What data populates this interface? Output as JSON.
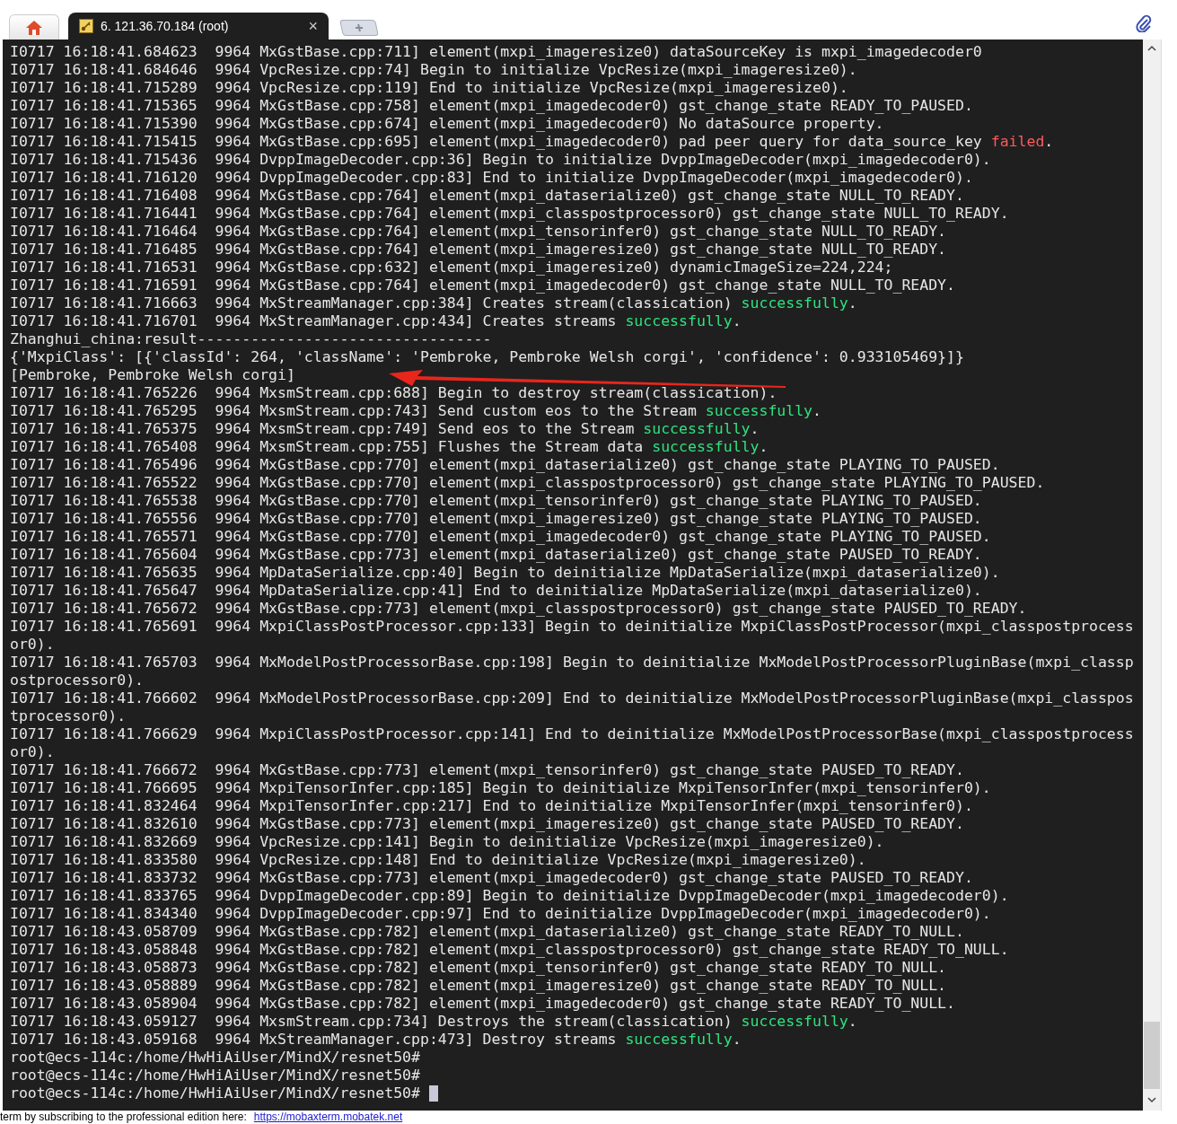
{
  "tabs": [
    {
      "kind": "home",
      "selected": false
    },
    {
      "kind": "session",
      "label": "6. 121.36.70.184 (root)",
      "close": "×",
      "selected": true
    },
    {
      "kind": "new",
      "selected": false
    }
  ],
  "terminal": {
    "cursor_visible": true,
    "lines": [
      {
        "segments": [
          {
            "kind": "plain",
            "text": "I0717 16:18:41.684623  9964 MxGstBase.cpp:711] element(mxpi_imageresize0) dataSourceKey is mxpi_imagedecoder0"
          }
        ]
      },
      {
        "segments": [
          {
            "kind": "plain",
            "text": "I0717 16:18:41.684646  9964 VpcResize.cpp:74] Begin to initialize VpcResize(mxpi_imageresize0)."
          }
        ]
      },
      {
        "segments": [
          {
            "kind": "plain",
            "text": "I0717 16:18:41.715289  9964 VpcResize.cpp:119] End to initialize VpcResize(mxpi_imageresize0)."
          }
        ]
      },
      {
        "segments": [
          {
            "kind": "plain",
            "text": "I0717 16:18:41.715365  9964 MxGstBase.cpp:758] element(mxpi_imagedecoder0) gst_change_state READY_TO_PAUSED."
          }
        ]
      },
      {
        "segments": [
          {
            "kind": "plain",
            "text": "I0717 16:18:41.715390  9964 MxGstBase.cpp:674] element(mxpi_imagedecoder0) No dataSource property."
          }
        ]
      },
      {
        "segments": [
          {
            "kind": "plain",
            "text": "I0717 16:18:41.715415  9964 MxGstBase.cpp:695] element(mxpi_imagedecoder0) pad peer query for data_source_key "
          },
          {
            "kind": "error",
            "text": "failed"
          },
          {
            "kind": "plain",
            "text": "."
          }
        ]
      },
      {
        "segments": [
          {
            "kind": "plain",
            "text": "I0717 16:18:41.715436  9964 DvppImageDecoder.cpp:36] Begin to initialize DvppImageDecoder(mxpi_imagedecoder0)."
          }
        ]
      },
      {
        "segments": [
          {
            "kind": "plain",
            "text": "I0717 16:18:41.716120  9964 DvppImageDecoder.cpp:83] End to initialize DvppImageDecoder(mxpi_imagedecoder0)."
          }
        ]
      },
      {
        "segments": [
          {
            "kind": "plain",
            "text": "I0717 16:18:41.716408  9964 MxGstBase.cpp:764] element(mxpi_dataserialize0) gst_change_state NULL_TO_READY."
          }
        ]
      },
      {
        "segments": [
          {
            "kind": "plain",
            "text": "I0717 16:18:41.716441  9964 MxGstBase.cpp:764] element(mxpi_classpostprocessor0) gst_change_state NULL_TO_READY."
          }
        ]
      },
      {
        "segments": [
          {
            "kind": "plain",
            "text": "I0717 16:18:41.716464  9964 MxGstBase.cpp:764] element(mxpi_tensorinfer0) gst_change_state NULL_TO_READY."
          }
        ]
      },
      {
        "segments": [
          {
            "kind": "plain",
            "text": "I0717 16:18:41.716485  9964 MxGstBase.cpp:764] element(mxpi_imageresize0) gst_change_state NULL_TO_READY."
          }
        ]
      },
      {
        "segments": [
          {
            "kind": "plain",
            "text": "I0717 16:18:41.716531  9964 MxGstBase.cpp:632] element(mxpi_imageresize0) dynamicImageSize=224,224;"
          }
        ]
      },
      {
        "segments": [
          {
            "kind": "plain",
            "text": "I0717 16:18:41.716591  9964 MxGstBase.cpp:764] element(mxpi_imagedecoder0) gst_change_state NULL_TO_READY."
          }
        ]
      },
      {
        "segments": [
          {
            "kind": "plain",
            "text": "I0717 16:18:41.716663  9964 MxStreamManager.cpp:384] Creates stream(classication) "
          },
          {
            "kind": "success",
            "text": "successfully"
          },
          {
            "kind": "plain",
            "text": "."
          }
        ]
      },
      {
        "segments": [
          {
            "kind": "plain",
            "text": "I0717 16:18:41.716701  9964 MxStreamManager.cpp:434] Creates streams "
          },
          {
            "kind": "success",
            "text": "successfully"
          },
          {
            "kind": "plain",
            "text": "."
          }
        ]
      },
      {
        "segments": [
          {
            "kind": "plain",
            "text": "Zhanghui_china:result---------------------------------"
          }
        ]
      },
      {
        "segments": [
          {
            "kind": "plain",
            "text": "{'MxpiClass': [{'classId': 264, 'className': 'Pembroke, Pembroke Welsh corgi', 'confidence': 0.933105469}]}"
          }
        ]
      },
      {
        "segments": [
          {
            "kind": "plain",
            "text": "[Pembroke, Pembroke Welsh corgi]"
          }
        ]
      },
      {
        "segments": [
          {
            "kind": "plain",
            "text": "I0717 16:18:41.765226  9964 MxsmStream.cpp:688] Begin to destroy stream(classication)."
          }
        ]
      },
      {
        "segments": [
          {
            "kind": "plain",
            "text": "I0717 16:18:41.765295  9964 MxsmStream.cpp:743] Send custom eos to the Stream "
          },
          {
            "kind": "success",
            "text": "successfully"
          },
          {
            "kind": "plain",
            "text": "."
          }
        ]
      },
      {
        "segments": [
          {
            "kind": "plain",
            "text": "I0717 16:18:41.765375  9964 MxsmStream.cpp:749] Send eos to the Stream "
          },
          {
            "kind": "success",
            "text": "successfully"
          },
          {
            "kind": "plain",
            "text": "."
          }
        ]
      },
      {
        "segments": [
          {
            "kind": "plain",
            "text": "I0717 16:18:41.765408  9964 MxsmStream.cpp:755] Flushes the Stream data "
          },
          {
            "kind": "success",
            "text": "successfully"
          },
          {
            "kind": "plain",
            "text": "."
          }
        ]
      },
      {
        "segments": [
          {
            "kind": "plain",
            "text": "I0717 16:18:41.765496  9964 MxGstBase.cpp:770] element(mxpi_dataserialize0) gst_change_state PLAYING_TO_PAUSED."
          }
        ]
      },
      {
        "segments": [
          {
            "kind": "plain",
            "text": "I0717 16:18:41.765522  9964 MxGstBase.cpp:770] element(mxpi_classpostprocessor0) gst_change_state PLAYING_TO_PAUSED."
          }
        ]
      },
      {
        "segments": [
          {
            "kind": "plain",
            "text": "I0717 16:18:41.765538  9964 MxGstBase.cpp:770] element(mxpi_tensorinfer0) gst_change_state PLAYING_TO_PAUSED."
          }
        ]
      },
      {
        "segments": [
          {
            "kind": "plain",
            "text": "I0717 16:18:41.765556  9964 MxGstBase.cpp:770] element(mxpi_imageresize0) gst_change_state PLAYING_TO_PAUSED."
          }
        ]
      },
      {
        "segments": [
          {
            "kind": "plain",
            "text": "I0717 16:18:41.765571  9964 MxGstBase.cpp:770] element(mxpi_imagedecoder0) gst_change_state PLAYING_TO_PAUSED."
          }
        ]
      },
      {
        "segments": [
          {
            "kind": "plain",
            "text": "I0717 16:18:41.765604  9964 MxGstBase.cpp:773] element(mxpi_dataserialize0) gst_change_state PAUSED_TO_READY."
          }
        ]
      },
      {
        "segments": [
          {
            "kind": "plain",
            "text": "I0717 16:18:41.765635  9964 MpDataSerialize.cpp:40] Begin to deinitialize MpDataSerialize(mxpi_dataserialize0)."
          }
        ]
      },
      {
        "segments": [
          {
            "kind": "plain",
            "text": "I0717 16:18:41.765647  9964 MpDataSerialize.cpp:41] End to deinitialize MpDataSerialize(mxpi_dataserialize0)."
          }
        ]
      },
      {
        "segments": [
          {
            "kind": "plain",
            "text": "I0717 16:18:41.765672  9964 MxGstBase.cpp:773] element(mxpi_classpostprocessor0) gst_change_state PAUSED_TO_READY."
          }
        ]
      },
      {
        "segments": [
          {
            "kind": "plain",
            "text": "I0717 16:18:41.765691  9964 MxpiClassPostProcessor.cpp:133] Begin to deinitialize MxpiClassPostProcessor(mxpi_classpostprocess"
          }
        ]
      },
      {
        "segments": [
          {
            "kind": "plain",
            "text": "or0)."
          }
        ]
      },
      {
        "segments": [
          {
            "kind": "plain",
            "text": "I0717 16:18:41.765703  9964 MxModelPostProcessorBase.cpp:198] Begin to deinitialize MxModelPostProcessorPluginBase(mxpi_classp"
          }
        ]
      },
      {
        "segments": [
          {
            "kind": "plain",
            "text": "ostprocessor0)."
          }
        ]
      },
      {
        "segments": [
          {
            "kind": "plain",
            "text": "I0717 16:18:41.766602  9964 MxModelPostProcessorBase.cpp:209] End to deinitialize MxModelPostProcessorPluginBase(mxpi_classpos"
          }
        ]
      },
      {
        "segments": [
          {
            "kind": "plain",
            "text": "tprocessor0)."
          }
        ]
      },
      {
        "segments": [
          {
            "kind": "plain",
            "text": "I0717 16:18:41.766629  9964 MxpiClassPostProcessor.cpp:141] End to deinitialize MxModelPostProcessorBase(mxpi_classpostprocess"
          }
        ]
      },
      {
        "segments": [
          {
            "kind": "plain",
            "text": "or0)."
          }
        ]
      },
      {
        "segments": [
          {
            "kind": "plain",
            "text": "I0717 16:18:41.766672  9964 MxGstBase.cpp:773] element(mxpi_tensorinfer0) gst_change_state PAUSED_TO_READY."
          }
        ]
      },
      {
        "segments": [
          {
            "kind": "plain",
            "text": "I0717 16:18:41.766695  9964 MxpiTensorInfer.cpp:185] Begin to deinitialize MxpiTensorInfer(mxpi_tensorinfer0)."
          }
        ]
      },
      {
        "segments": [
          {
            "kind": "plain",
            "text": "I0717 16:18:41.832464  9964 MxpiTensorInfer.cpp:217] End to deinitialize MxpiTensorInfer(mxpi_tensorinfer0)."
          }
        ]
      },
      {
        "segments": [
          {
            "kind": "plain",
            "text": "I0717 16:18:41.832610  9964 MxGstBase.cpp:773] element(mxpi_imageresize0) gst_change_state PAUSED_TO_READY."
          }
        ]
      },
      {
        "segments": [
          {
            "kind": "plain",
            "text": "I0717 16:18:41.832669  9964 VpcResize.cpp:141] Begin to deinitialize VpcResize(mxpi_imageresize0)."
          }
        ]
      },
      {
        "segments": [
          {
            "kind": "plain",
            "text": "I0717 16:18:41.833580  9964 VpcResize.cpp:148] End to deinitialize VpcResize(mxpi_imageresize0)."
          }
        ]
      },
      {
        "segments": [
          {
            "kind": "plain",
            "text": "I0717 16:18:41.833732  9964 MxGstBase.cpp:773] element(mxpi_imagedecoder0) gst_change_state PAUSED_TO_READY."
          }
        ]
      },
      {
        "segments": [
          {
            "kind": "plain",
            "text": "I0717 16:18:41.833765  9964 DvppImageDecoder.cpp:89] Begin to deinitialize DvppImageDecoder(mxpi_imagedecoder0)."
          }
        ]
      },
      {
        "segments": [
          {
            "kind": "plain",
            "text": "I0717 16:18:41.834340  9964 DvppImageDecoder.cpp:97] End to deinitialize DvppImageDecoder(mxpi_imagedecoder0)."
          }
        ]
      },
      {
        "segments": [
          {
            "kind": "plain",
            "text": "I0717 16:18:43.058709  9964 MxGstBase.cpp:782] element(mxpi_dataserialize0) gst_change_state READY_TO_NULL."
          }
        ]
      },
      {
        "segments": [
          {
            "kind": "plain",
            "text": "I0717 16:18:43.058848  9964 MxGstBase.cpp:782] element(mxpi_classpostprocessor0) gst_change_state READY_TO_NULL."
          }
        ]
      },
      {
        "segments": [
          {
            "kind": "plain",
            "text": "I0717 16:18:43.058873  9964 MxGstBase.cpp:782] element(mxpi_tensorinfer0) gst_change_state READY_TO_NULL."
          }
        ]
      },
      {
        "segments": [
          {
            "kind": "plain",
            "text": "I0717 16:18:43.058889  9964 MxGstBase.cpp:782] element(mxpi_imageresize0) gst_change_state READY_TO_NULL."
          }
        ]
      },
      {
        "segments": [
          {
            "kind": "plain",
            "text": "I0717 16:18:43.058904  9964 MxGstBase.cpp:782] element(mxpi_imagedecoder0) gst_change_state READY_TO_NULL."
          }
        ]
      },
      {
        "segments": [
          {
            "kind": "plain",
            "text": "I0717 16:18:43.059127  9964 MxsmStream.cpp:734] Destroys the stream(classication) "
          },
          {
            "kind": "success",
            "text": "successfully"
          },
          {
            "kind": "plain",
            "text": "."
          }
        ]
      },
      {
        "segments": [
          {
            "kind": "plain",
            "text": "I0717 16:18:43.059168  9964 MxStreamManager.cpp:473] Destroy streams "
          },
          {
            "kind": "success",
            "text": "successfully"
          },
          {
            "kind": "plain",
            "text": "."
          }
        ]
      },
      {
        "segments": [
          {
            "kind": "plain",
            "text": "root@ecs-114c:/home/HwHiAiUser/MindX/resnet50#"
          }
        ]
      },
      {
        "segments": [
          {
            "kind": "plain",
            "text": "root@ecs-114c:/home/HwHiAiUser/MindX/resnet50#"
          }
        ]
      },
      {
        "segments": [
          {
            "kind": "plain",
            "text": "root@ecs-114c:/home/HwHiAiUser/MindX/resnet50# "
          }
        ]
      }
    ]
  },
  "footer": {
    "text": "term by subscribing to the professional edition here:",
    "link": "https://mobaxterm.mobatek.net"
  }
}
